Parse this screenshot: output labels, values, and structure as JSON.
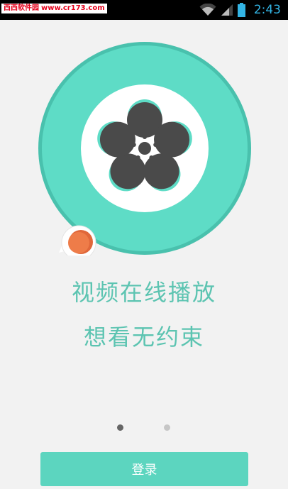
{
  "status_bar": {
    "watermark_text": "西西软件园",
    "watermark_url": "www.cr173.com",
    "time": "2:43",
    "icons": [
      "wifi-icon",
      "signal-icon",
      "battery-icon"
    ]
  },
  "hero": {
    "icon": "film-reel-icon",
    "badge_icon": "cup-icon"
  },
  "slogans": {
    "line1": "视频在线播放",
    "line2": "想看无约束"
  },
  "pager": {
    "total": 2,
    "active_index": 0
  },
  "login_button_label": "登录",
  "colors": {
    "accent": "#5cd5bf",
    "text_accent": "#5cc4b1",
    "badge_orange": "#ee7c49",
    "status_blue": "#33b5e5"
  }
}
